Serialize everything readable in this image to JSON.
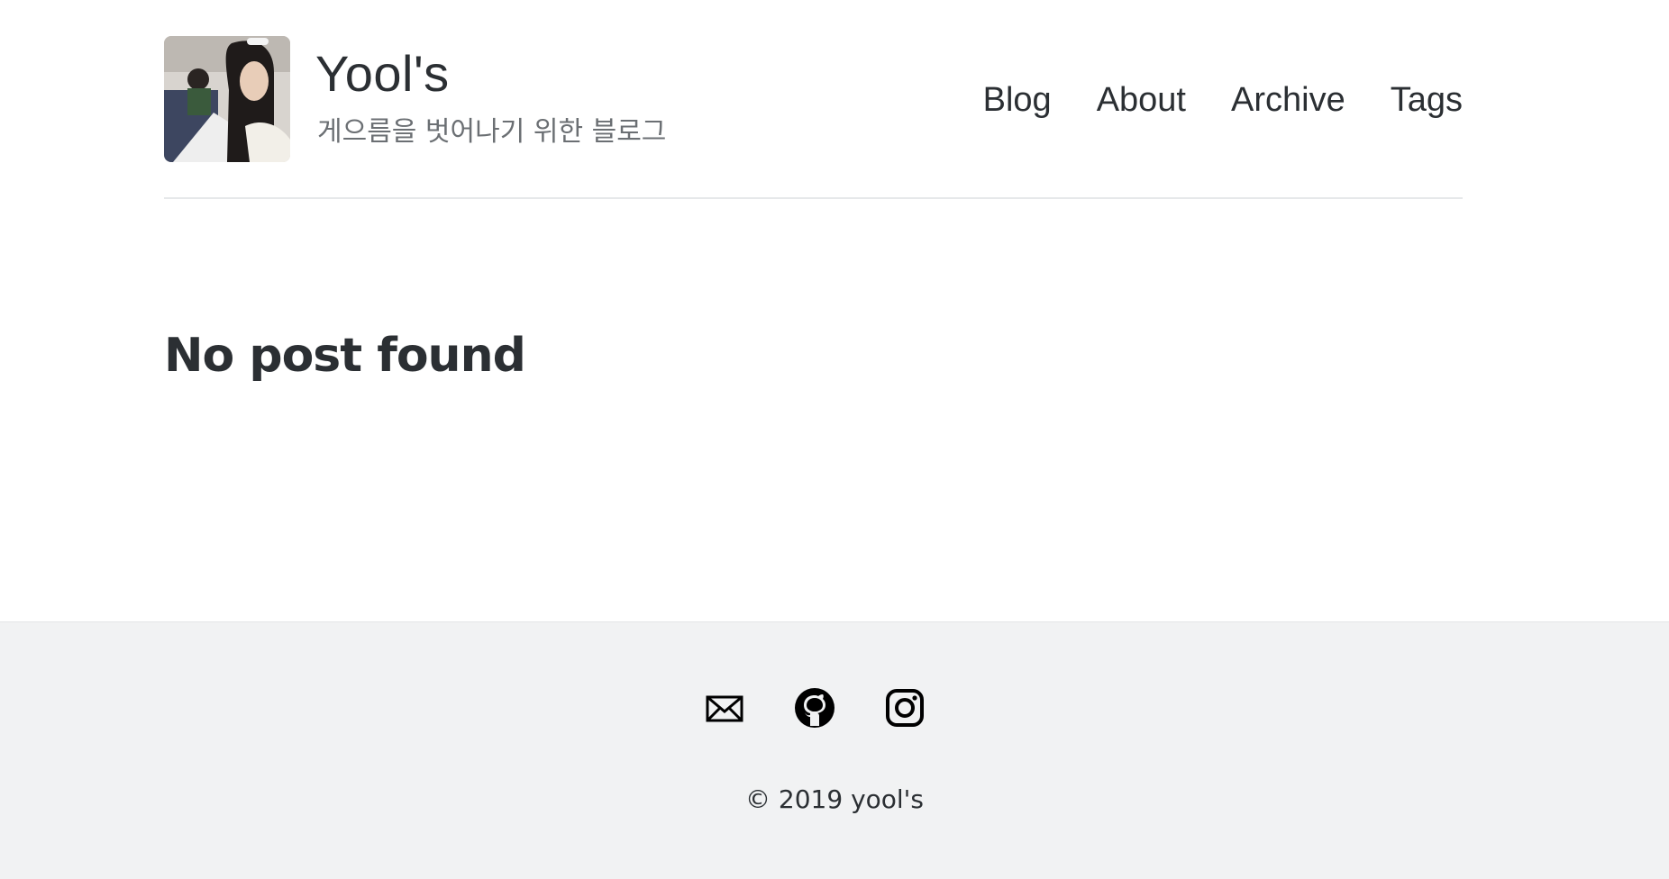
{
  "header": {
    "title": "Yool's",
    "tagline": "게으름을 벗어나기 위한 블로그",
    "nav": [
      {
        "label": "Blog"
      },
      {
        "label": "About"
      },
      {
        "label": "Archive"
      },
      {
        "label": "Tags"
      }
    ]
  },
  "main": {
    "heading": "No post found"
  },
  "footer": {
    "social": [
      {
        "icon": "mail-icon"
      },
      {
        "icon": "github-icon"
      },
      {
        "icon": "instagram-icon"
      }
    ],
    "copyright": "© 2019 yool's"
  },
  "colors": {
    "text": "#2b2f33",
    "tagline": "#6b6f73",
    "footer_bg": "#f1f2f3",
    "divider": "#e6e8ea"
  }
}
